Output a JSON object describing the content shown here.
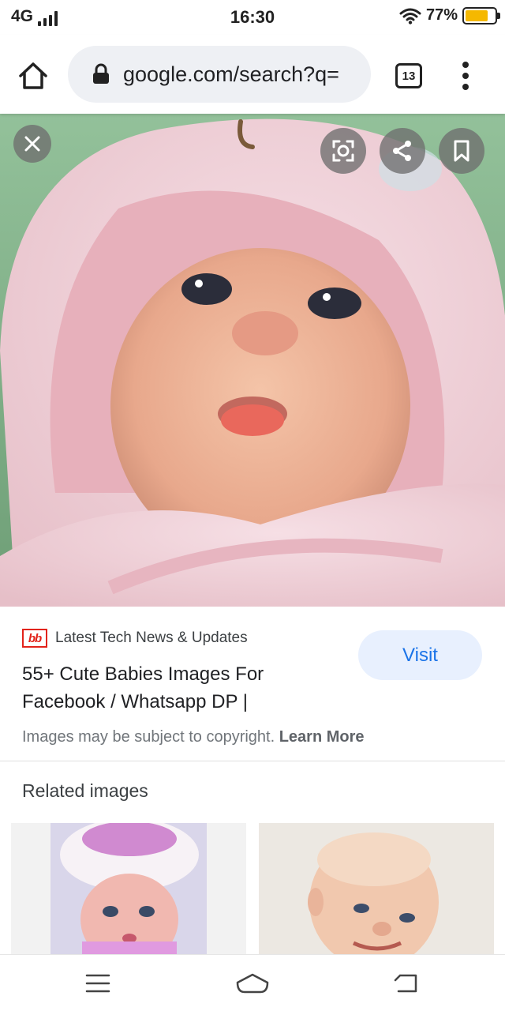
{
  "status_bar": {
    "network": "4G",
    "time": "16:30",
    "battery_percent": "77%",
    "battery_level": 0.77,
    "icons": [
      "signal-icon",
      "wifi-icon",
      "battery-icon"
    ]
  },
  "browser": {
    "url": "google.com/search?q=",
    "tab_count": "13",
    "icons": [
      "home-icon",
      "lock-icon",
      "tabs-icon",
      "more-menu-icon"
    ]
  },
  "viewer": {
    "icons": [
      "close-icon",
      "lens-icon",
      "share-icon",
      "bookmark-icon"
    ]
  },
  "result": {
    "favicon_text": "bb",
    "favicon_color": "#e2231a",
    "source": "Latest Tech News & Updates",
    "title_line1": "55+ Cute Babies Images For",
    "title_line2": "Facebook / Whatsapp DP |",
    "visit_label": "Visit",
    "copyright_text": "Images may be subject to copyright.",
    "learn_more": "Learn More"
  },
  "related": {
    "heading": "Related images"
  },
  "nav_bar": {
    "icons": [
      "menu-icon",
      "home-nav-icon",
      "back-icon"
    ]
  },
  "colors": {
    "accent": "#1a73e8",
    "visit_bg": "#e8f0fe",
    "battery": "#f5b800"
  }
}
